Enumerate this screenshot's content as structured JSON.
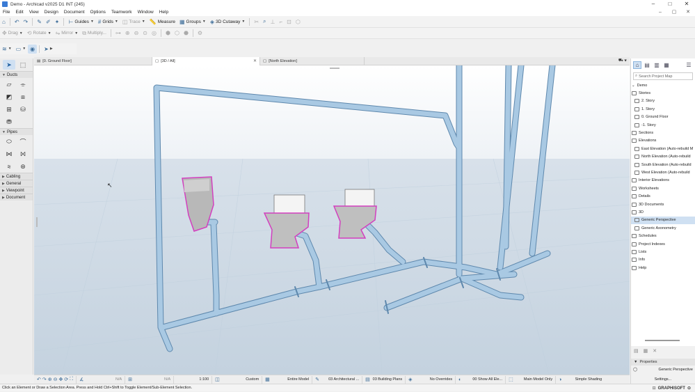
{
  "window": {
    "title": "Demo - Archicad v2025 D1 INT (245)",
    "controls": [
      "–",
      "□",
      "✕"
    ],
    "sub_controls": [
      "–",
      "▢",
      "✕"
    ]
  },
  "menu": [
    "File",
    "Edit",
    "View",
    "Design",
    "Document",
    "Options",
    "Teamwork",
    "Window",
    "Help"
  ],
  "toolbar1": {
    "guides": "Guides",
    "grids": "Grids",
    "trace": "Trace",
    "measure": "Measure",
    "groups": "Groups",
    "cutaway": "3D Cutaway"
  },
  "toolbar2": {
    "drag": "Drag",
    "rotate": "Rotate",
    "mirror": "Mirror",
    "multiply": "Multiply..."
  },
  "toolbox": {
    "groups": [
      {
        "label": "Ducts",
        "expanded": true
      },
      {
        "label": "Pipes",
        "expanded": true
      },
      {
        "label": "Cabling",
        "expanded": false
      },
      {
        "label": "General",
        "expanded": false
      },
      {
        "label": "Viewpoint",
        "expanded": false
      },
      {
        "label": "Document",
        "expanded": false
      }
    ]
  },
  "tabs": [
    {
      "label": "[0. Ground Floor]",
      "active": false
    },
    {
      "label": "[3D / All]",
      "active": true
    },
    {
      "label": "[North Elevation]",
      "active": false
    }
  ],
  "navigator": {
    "search_placeholder": "Search Project Map",
    "items": [
      {
        "label": "Demo",
        "level": 0,
        "selected": false
      },
      {
        "label": "Stories",
        "level": 0,
        "selected": false
      },
      {
        "label": "2. Story",
        "level": 1,
        "selected": false
      },
      {
        "label": "1. Story",
        "level": 1,
        "selected": false
      },
      {
        "label": "0. Ground Floor",
        "level": 1,
        "selected": false
      },
      {
        "label": "-1. Story",
        "level": 1,
        "selected": false
      },
      {
        "label": "Sections",
        "level": 0,
        "selected": false
      },
      {
        "label": "Elevations",
        "level": 0,
        "selected": false
      },
      {
        "label": "East Elevation (Auto-rebuild M",
        "level": 1,
        "selected": false
      },
      {
        "label": "North Elevation (Auto-rebuild",
        "level": 1,
        "selected": false
      },
      {
        "label": "South Elevation (Auto-rebuild",
        "level": 1,
        "selected": false
      },
      {
        "label": "West Elevation (Auto-rebuild",
        "level": 1,
        "selected": false
      },
      {
        "label": "Interior Elevations",
        "level": 0,
        "selected": false
      },
      {
        "label": "Worksheets",
        "level": 0,
        "selected": false
      },
      {
        "label": "Details",
        "level": 0,
        "selected": false
      },
      {
        "label": "3D Documents",
        "level": 0,
        "selected": false
      },
      {
        "label": "3D",
        "level": 0,
        "selected": false
      },
      {
        "label": "Generic Perspective",
        "level": 1,
        "selected": true
      },
      {
        "label": "Generic Axonometry",
        "level": 1,
        "selected": false
      },
      {
        "label": "Schedules",
        "level": 0,
        "selected": false
      },
      {
        "label": "Project Indexes",
        "level": 0,
        "selected": false
      },
      {
        "label": "Lists",
        "level": 0,
        "selected": false
      },
      {
        "label": "Info",
        "level": 0,
        "selected": false
      },
      {
        "label": "Help",
        "level": 0,
        "selected": false
      }
    ]
  },
  "properties": {
    "header": "Properties",
    "view_name": "Generic Perspective",
    "settings": "Settings..."
  },
  "statusbar": {
    "na1": "N/A",
    "na2": "N/A",
    "scale": "1:100",
    "custom": "Custom",
    "entire_model": "Entire Model",
    "architectural": "03 Architectural ...",
    "building_plans": "03 Building Plans",
    "no_overrides": "No Overrides",
    "show_all": "00 Show All Ele...",
    "main_model": "Main Model Only",
    "shading": "Simple Shading"
  },
  "message": "Click an Element or Draw a Selection Area. Press and Hold Ctrl+Shift to Toggle Element/Sub-Element Selection.",
  "brand": "GRAPHISOFT",
  "colors": {
    "pipe": "#a9c9e3",
    "pipe_edge": "#5e88ad",
    "fixture_highlight": "#d33fbf",
    "selection": "#cfe0f2"
  }
}
